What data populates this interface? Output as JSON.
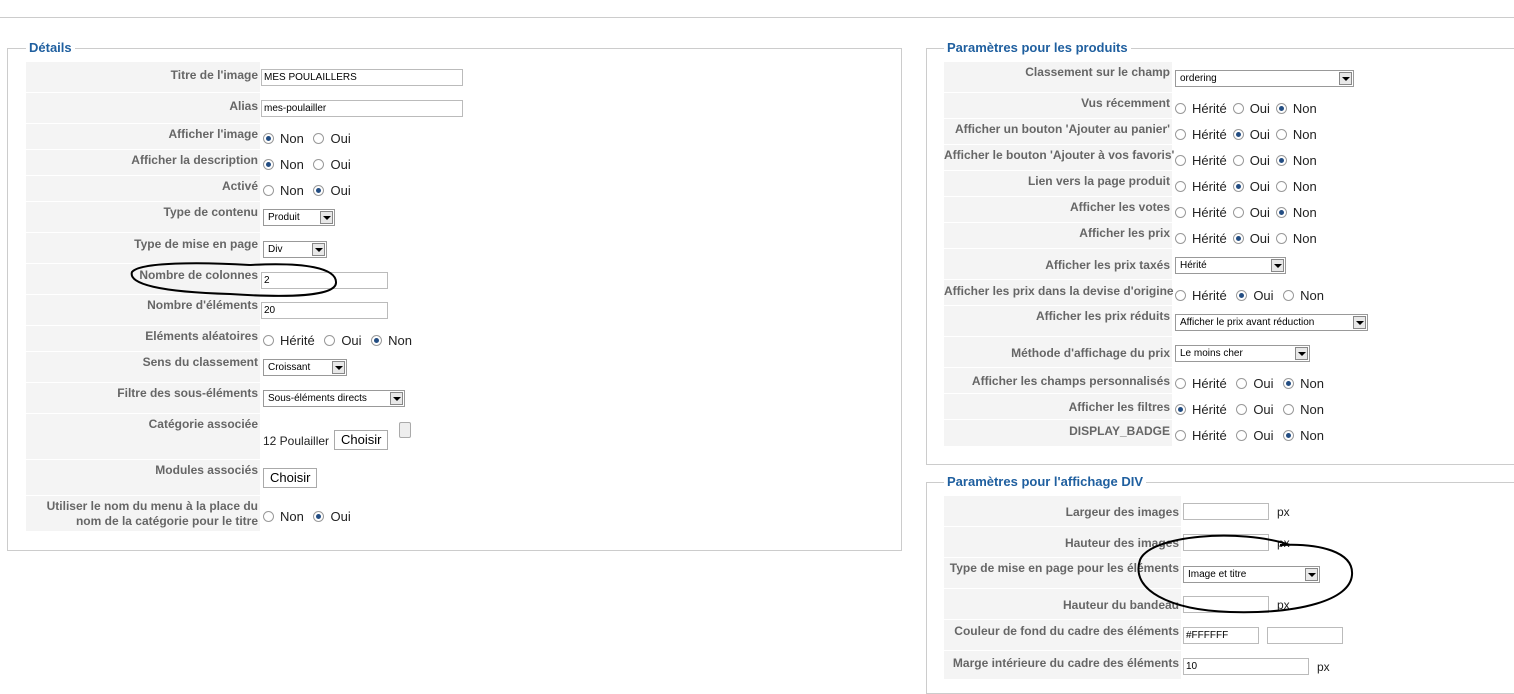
{
  "details": {
    "legend": "Détails",
    "title_label": "Titre de l'image",
    "title_value": "MES POULAILLERS",
    "alias_label": "Alias",
    "alias_value": "mes-poulailler",
    "show_image_label": "Afficher l'image",
    "show_image_options": [
      "Non",
      "Oui"
    ],
    "show_image_selected": "Non",
    "show_desc_label": "Afficher la description",
    "show_desc_options": [
      "Non",
      "Oui"
    ],
    "show_desc_selected": "Non",
    "active_label": "Activé",
    "active_options": [
      "Non",
      "Oui"
    ],
    "active_selected": "Oui",
    "content_type_label": "Type de contenu",
    "content_type_value": "Produit",
    "layout_type_label": "Type de mise en page",
    "layout_type_value": "Div",
    "columns_label": "Nombre de colonnes",
    "columns_value": "2",
    "elements_label": "Nombre d'éléments",
    "elements_value": "20",
    "random_label": "Eléments aléatoires",
    "random_options": [
      "Hérité",
      "Oui",
      "Non"
    ],
    "random_selected": "Non",
    "order_label": "Sens du classement",
    "order_value": "Croissant",
    "filter_label": "Filtre des sous-éléments",
    "filter_value": "Sous-éléments directs",
    "category_label": "Catégorie associée",
    "category_value": "12 Poulailler",
    "category_button": "Choisir",
    "modules_label": "Modules associés",
    "modules_button": "Choisir",
    "menu_name_label": "Utiliser le nom du menu à la place du nom de la catégorie pour le titre",
    "menu_name_options": [
      "Non",
      "Oui"
    ],
    "menu_name_selected": "Oui"
  },
  "products": {
    "legend": "Paramètres pour les produits",
    "sort_label": "Classement sur le champ",
    "sort_value": "ordering",
    "radio_rows": [
      {
        "label": "Vus récemment",
        "selected": "Non"
      },
      {
        "label": "Afficher un bouton 'Ajouter au panier'",
        "selected": "Oui"
      },
      {
        "label": "Afficher le bouton 'Ajouter à vos favoris'",
        "selected": "Non"
      },
      {
        "label": "Lien vers la page produit",
        "selected": "Oui"
      },
      {
        "label": "Afficher les votes",
        "selected": "Non"
      },
      {
        "label": "Afficher les prix",
        "selected": "Oui"
      }
    ],
    "radio_options": [
      "Hérité",
      "Oui",
      "Non"
    ],
    "taxed_label": "Afficher les prix taxés",
    "taxed_value": "Hérité",
    "currency_label": "Afficher les prix dans la devise d'origine",
    "currency_selected": "Oui",
    "reduced_label": "Afficher les prix réduits",
    "reduced_value": "Afficher le prix avant réduction",
    "method_label": "Méthode d'affichage du prix",
    "method_value": "Le moins cher",
    "custom_label": "Afficher les champs personnalisés",
    "custom_selected": "Non",
    "filters_label": "Afficher les filtres",
    "filters_selected": "Hérité",
    "badge_label": "DISPLAY_BADGE",
    "badge_selected": "Non"
  },
  "div": {
    "legend": "Paramètres pour l'affichage DIV",
    "img_width_label": "Largeur des images",
    "img_height_label": "Hauteur des images",
    "elem_layout_label": "Type de mise en page pour les éléments",
    "elem_layout_value": "Image et titre",
    "banner_height_label": "Hauteur du bandeau",
    "bg_color_label": "Couleur de fond du cadre des éléments",
    "bg_color_value": "#FFFFFF",
    "padding_label": "Marge intérieure du cadre des éléments",
    "padding_value": "10",
    "unit": "px"
  }
}
